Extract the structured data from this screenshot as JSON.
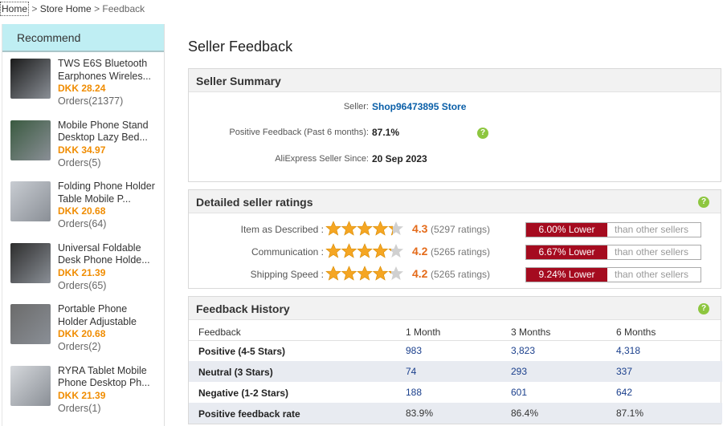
{
  "breadcrumb": {
    "home": "Home",
    "sep1": " > ",
    "store_home": "Store Home",
    "sep2": " > ",
    "current": "Feedback"
  },
  "sidebar": {
    "title": "Recommend",
    "products": [
      {
        "title": "TWS E6S Bluetooth Earphones Wireles...",
        "price": "DKK 28.24",
        "orders": "Orders(21377)",
        "thumb_color": "#1b1b1b"
      },
      {
        "title": "Mobile Phone Stand Desktop Lazy Bed...",
        "price": "DKK 34.97",
        "orders": "Orders(5)",
        "thumb_color": "#3a5a40"
      },
      {
        "title": "Folding Phone Holder Table Mobile P...",
        "price": "DKK 20.68",
        "orders": "Orders(64)",
        "thumb_color": "#c8ccd2"
      },
      {
        "title": "Universal Foldable Desk Phone Holde...",
        "price": "DKK 21.39",
        "orders": "Orders(65)",
        "thumb_color": "#2d2d2d"
      },
      {
        "title": "Portable Phone Holder Adjustable",
        "price": "DKK 20.68",
        "orders": "Orders(2)",
        "thumb_color": "#6b6b6b"
      },
      {
        "title": "RYRA Tablet Mobile Phone Desktop Ph...",
        "price": "DKK 21.39",
        "orders": "Orders(1)",
        "thumb_color": "#d5d8dc"
      }
    ]
  },
  "main": {
    "title": "Seller Feedback",
    "summary": {
      "title": "Seller Summary",
      "seller_label": "Seller:",
      "seller_value": "Shop96473895 Store",
      "positive_label": "Positive Feedback (Past 6 months):",
      "positive_value": "87.1%",
      "since_label": "AliExpress Seller Since:",
      "since_value": "20 Sep 2023",
      "help_icon": "?"
    },
    "ratings": {
      "title": "Detailed seller ratings",
      "help_icon": "?",
      "rows": [
        {
          "label": "Item as Described :",
          "stars": 4.3,
          "score": "4.3",
          "count": "(5297 ratings)",
          "lower": "6.00% Lower",
          "than": "than other sellers"
        },
        {
          "label": "Communication :",
          "stars": 4.2,
          "score": "4.2",
          "count": "(5265 ratings)",
          "lower": "6.67% Lower",
          "than": "than other sellers"
        },
        {
          "label": "Shipping Speed :",
          "stars": 4.2,
          "score": "4.2",
          "count": "(5265 ratings)",
          "lower": "9.24% Lower",
          "than": "than other sellers"
        }
      ]
    },
    "history": {
      "title": "Feedback History",
      "help_icon": "?",
      "columns": [
        "Feedback",
        "1 Month",
        "3 Months",
        "6 Months"
      ],
      "rows": [
        {
          "label": "Positive (4-5 Stars)",
          "m1": "983",
          "m3": "3,823",
          "m6": "4,318"
        },
        {
          "label": "Neutral (3 Stars)",
          "m1": "74",
          "m3": "293",
          "m6": "337"
        },
        {
          "label": "Negative (1-2 Stars)",
          "m1": "188",
          "m3": "601",
          "m6": "642"
        },
        {
          "label": "Positive feedback rate",
          "m1": "83.9%",
          "m3": "86.4%",
          "m6": "87.1%"
        }
      ]
    }
  },
  "colors": {
    "accent_orange": "#f08c00",
    "score_orange": "#e46b1a",
    "lower_red": "#a50b1f",
    "help_green": "#8dc63f",
    "link_blue": "#0a5fa8",
    "star_gold": "#f5a623"
  }
}
